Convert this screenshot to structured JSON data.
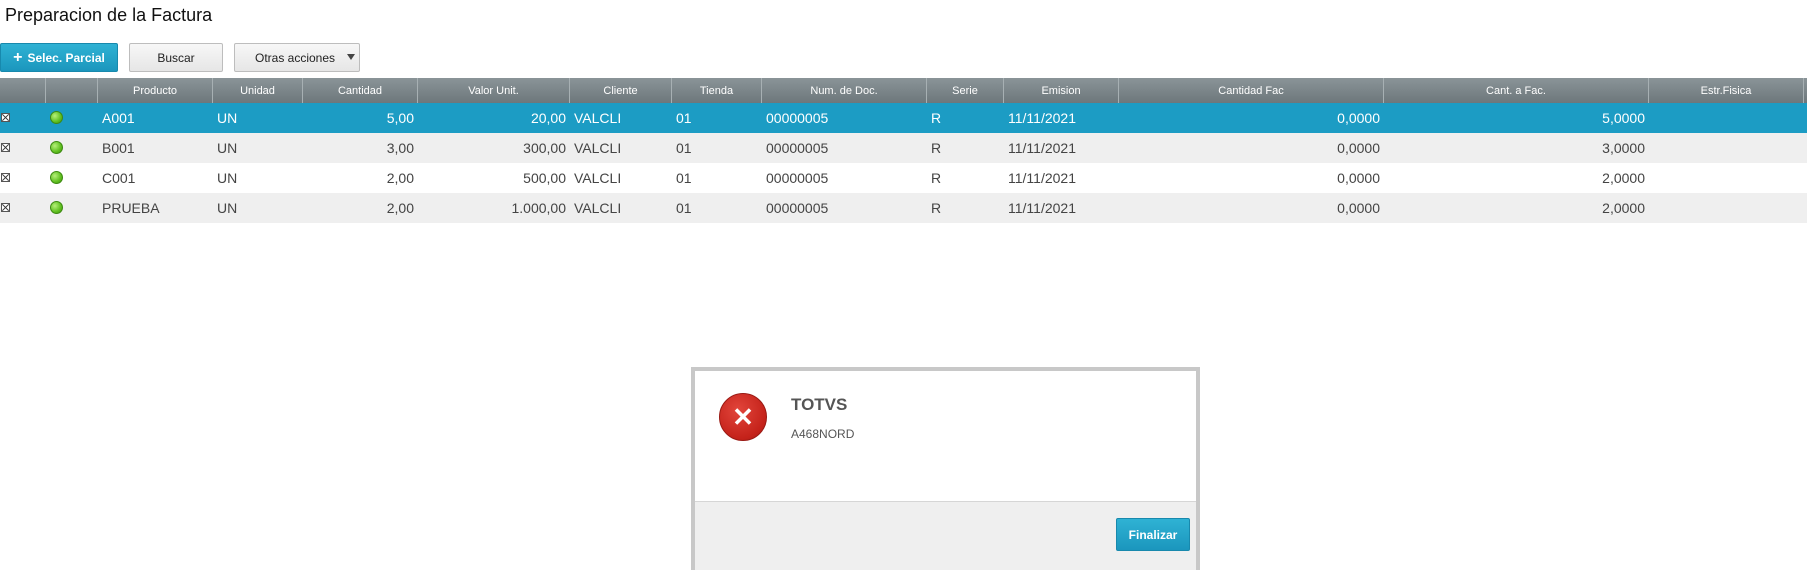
{
  "page": {
    "title": "Preparacion de la Factura"
  },
  "toolbar": {
    "sel_parcial_label": "Selec. Parcial",
    "buscar_label": "Buscar",
    "otras_label": "Otras acciones"
  },
  "grid": {
    "columns": [
      "",
      "",
      "Producto",
      "Unidad",
      "Cantidad",
      "Valor Unit.",
      "Cliente",
      "Tienda",
      "Num. de Doc.",
      "Serie",
      "Emision",
      "Cantidad Fac",
      "Cant. a Fac.",
      "Estr.Fisica"
    ],
    "rows": [
      {
        "producto": "A001",
        "unidad": "UN",
        "cantidad": "5,00",
        "valor_unit": "20,00",
        "cliente": "VALCLI",
        "tienda": "01",
        "num_doc": "00000005",
        "serie": "R",
        "emision": "11/11/2021",
        "cantidad_fac": "0,0000",
        "cant_a_fac": "5,0000",
        "estr_fisica": ""
      },
      {
        "producto": "B001",
        "unidad": "UN",
        "cantidad": "3,00",
        "valor_unit": "300,00",
        "cliente": "VALCLI",
        "tienda": "01",
        "num_doc": "00000005",
        "serie": "R",
        "emision": "11/11/2021",
        "cantidad_fac": "0,0000",
        "cant_a_fac": "3,0000",
        "estr_fisica": ""
      },
      {
        "producto": "C001",
        "unidad": "UN",
        "cantidad": "2,00",
        "valor_unit": "500,00",
        "cliente": "VALCLI",
        "tienda": "01",
        "num_doc": "00000005",
        "serie": "R",
        "emision": "11/11/2021",
        "cantidad_fac": "0,0000",
        "cant_a_fac": "2,0000",
        "estr_fisica": ""
      },
      {
        "producto": "PRUEBA",
        "unidad": "UN",
        "cantidad": "2,00",
        "valor_unit": "1.000,00",
        "cliente": "VALCLI",
        "tienda": "01",
        "num_doc": "00000005",
        "serie": "R",
        "emision": "11/11/2021",
        "cantidad_fac": "0,0000",
        "cant_a_fac": "2,0000",
        "estr_fisica": ""
      }
    ]
  },
  "dialog": {
    "title": "TOTVS",
    "message": "A468NORD",
    "button_label": "Finalizar",
    "icon": "error-x-icon"
  },
  "colors": {
    "accent": "#1c9cc4",
    "header": "#7a8488",
    "error": "#c4221a",
    "status_ok": "#5fbf1f"
  }
}
